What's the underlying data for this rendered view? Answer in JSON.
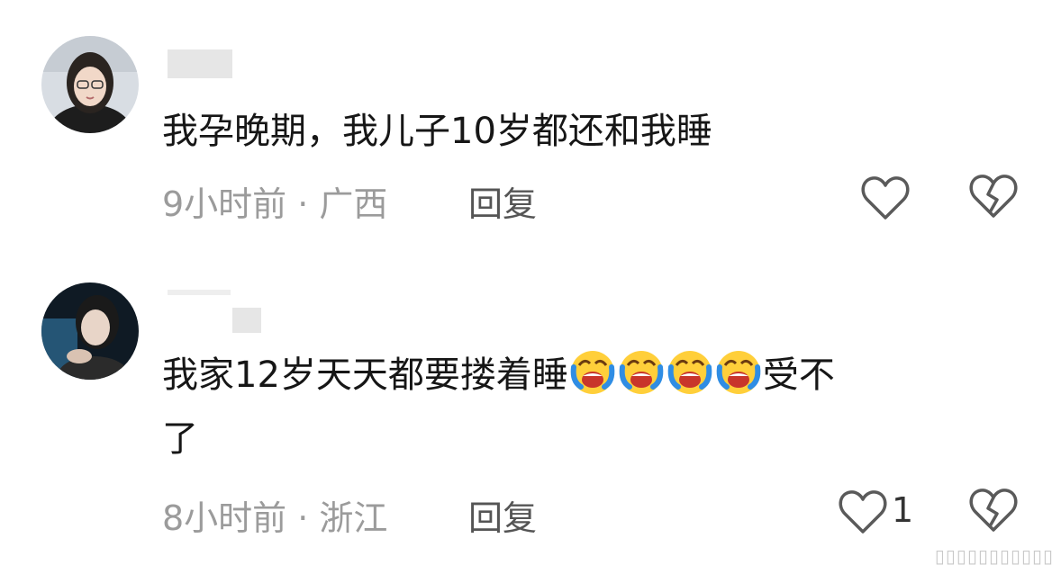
{
  "comments": [
    {
      "text": "我孕晚期，我儿子10岁都还和我睡",
      "time_location": "9小时前 · 广西",
      "reply_label": "回复",
      "like_count": ""
    },
    {
      "text_line1": "我家12岁天天都要搂着睡",
      "emoji_name": "laughing-tears-emoji",
      "emoji_count": 4,
      "text_after_emoji": "受不",
      "text_line2": "了",
      "time_location": "8小时前 · 浙江",
      "reply_label": "回复",
      "like_count": "1"
    }
  ],
  "icons": {
    "like": "heart-outline-icon",
    "dislike": "broken-heart-icon"
  },
  "colors": {
    "text": "#161616",
    "meta": "#9b9b9b",
    "reply": "#555555",
    "icon": "#5a5a5a"
  }
}
